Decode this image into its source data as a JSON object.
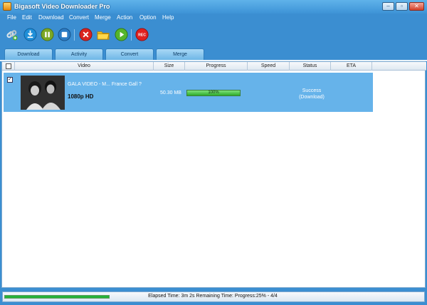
{
  "window": {
    "title": "Bigasoft Video Downloader Pro",
    "controls": {
      "minimize": "–",
      "restore": "▫",
      "close": "✕"
    }
  },
  "menu": [
    "File",
    "Edit",
    "Download",
    "Convert",
    "Merge",
    "Action",
    "Option",
    "Help"
  ],
  "toolbar": {
    "icons": [
      "add-link-icon",
      "download-icon",
      "pause-icon",
      "stop-icon",
      "delete-icon",
      "open-folder-icon",
      "play-icon",
      "record-icon"
    ],
    "record_label": "REC"
  },
  "tabs": [
    "Download",
    "Activity",
    "Convert",
    "Merge"
  ],
  "table": {
    "columns": [
      "Video",
      "Size",
      "Progress",
      "Speed",
      "Status",
      "ETA"
    ],
    "rows": [
      {
        "checked": "✓",
        "title": "GALA VIDEO - M... France Gall ?",
        "quality": "1080p HD",
        "size": "50.30 MB",
        "progress": 1.0,
        "progress_label": "100%",
        "speed": "",
        "status": "Success",
        "status_sub": "(Download)",
        "eta": ""
      }
    ]
  },
  "statusbar": {
    "progress": 0.25,
    "text": "Elapsed Time: 3m  2s Remaining Time: Progress:25% - 4/4"
  },
  "colors": {
    "accent": "#3b8ed1",
    "row_selected": "#66b3ea",
    "progress_green": "#2caa2a"
  }
}
